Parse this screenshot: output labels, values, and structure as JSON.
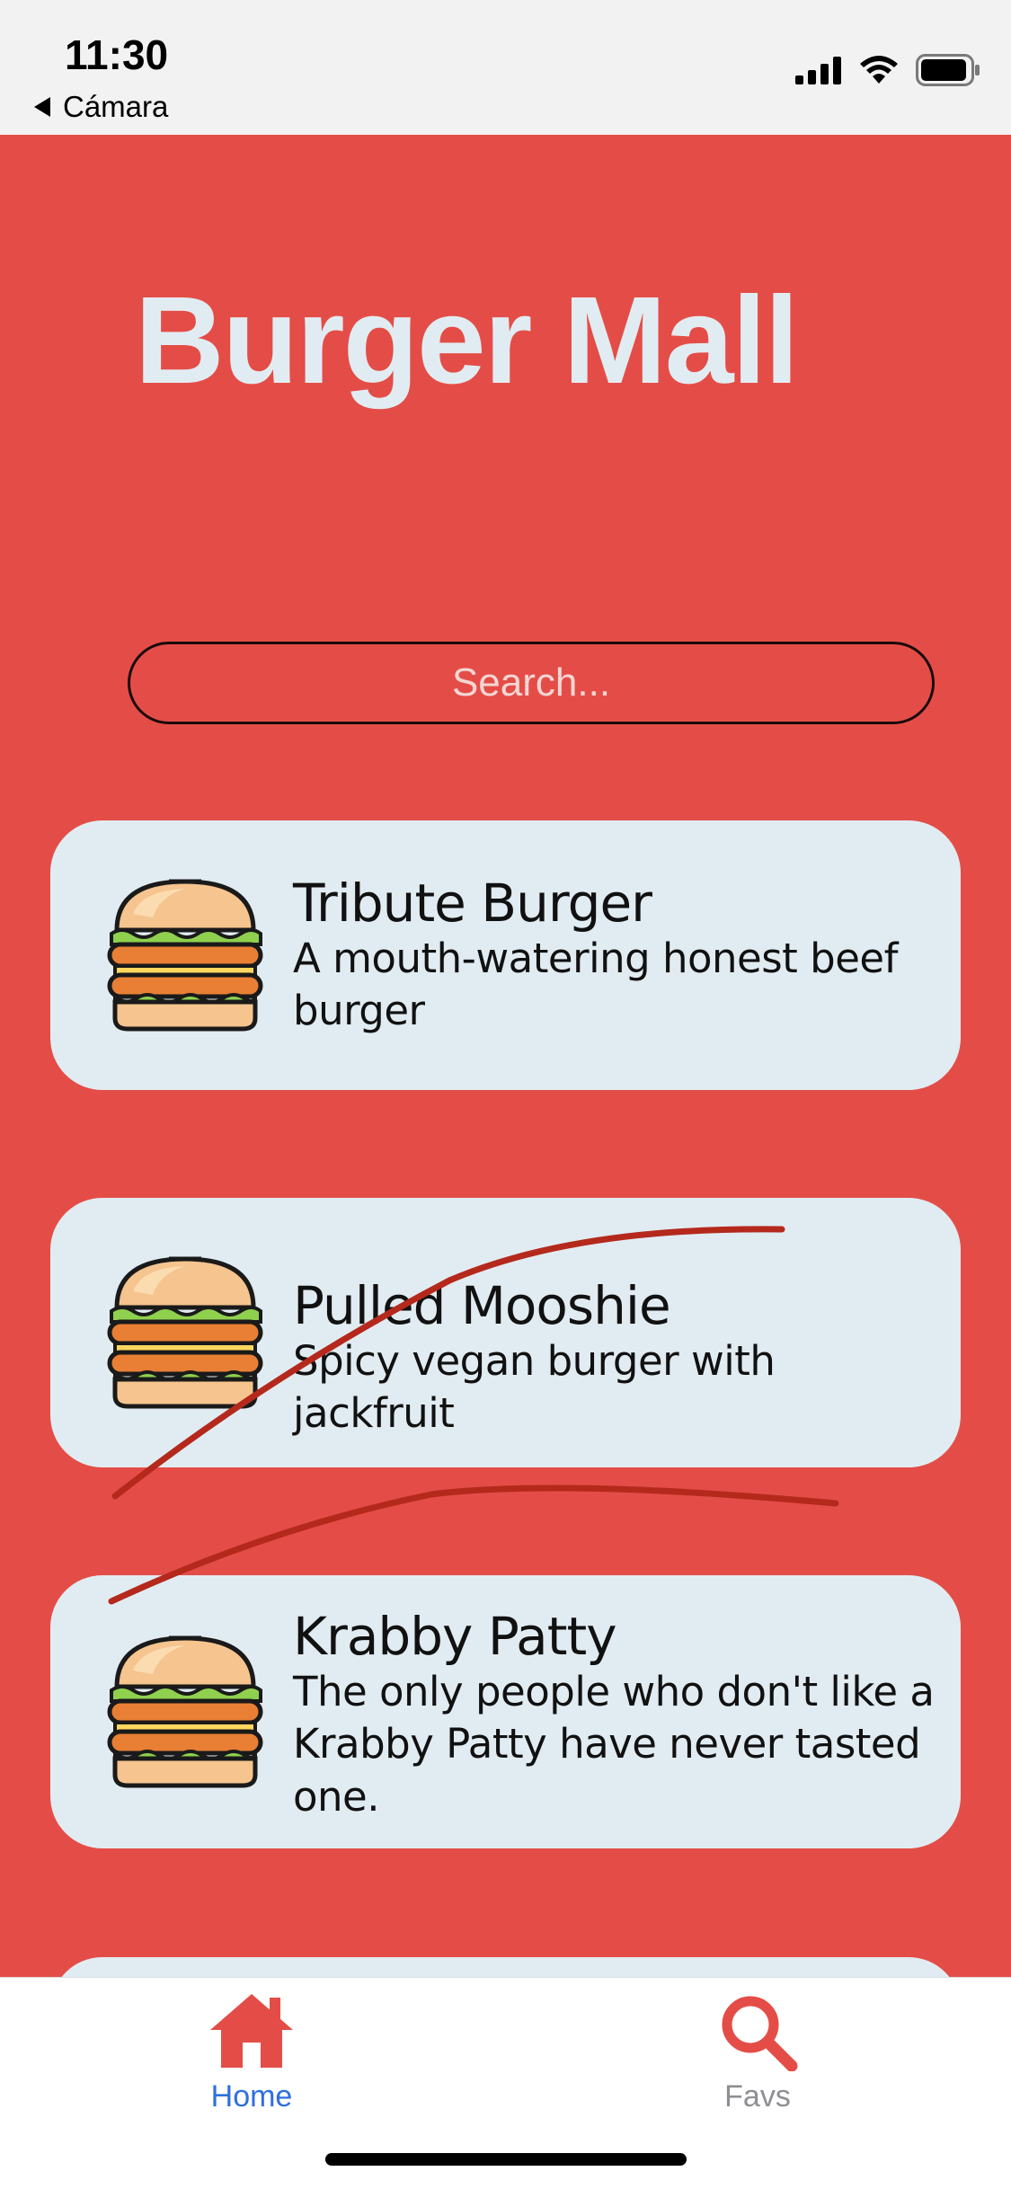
{
  "status_bar": {
    "time": "11:30",
    "back_label": "Cámara",
    "icons": [
      "signal-icon",
      "wifi-icon",
      "battery-icon"
    ]
  },
  "header": {
    "title": "Burger Mall"
  },
  "search": {
    "placeholder": "Search..."
  },
  "burgers": [
    {
      "name": "Tribute Burger",
      "description": "A mouth-watering honest beef burger",
      "icon": "burger-icon"
    },
    {
      "name": "Pulled Mooshie",
      "description": "Spicy vegan burger with jackfruit",
      "icon": "burger-icon"
    },
    {
      "name": "Krabby Patty",
      "description": "The only people who don't like a Krabby Patty have never tasted one.",
      "icon": "burger-icon"
    }
  ],
  "tab_bar": {
    "tabs": [
      {
        "label": "Home",
        "icon": "home-icon",
        "active": true
      },
      {
        "label": "Favs",
        "icon": "search-icon",
        "active": false
      }
    ]
  },
  "colors": {
    "background": "#e44d47",
    "card": "#e1ecf2",
    "title": "#e1ecf2",
    "active_tab": "#2f6fe0",
    "inactive_tab": "#8e8e93",
    "scribble": "#b5291d"
  }
}
